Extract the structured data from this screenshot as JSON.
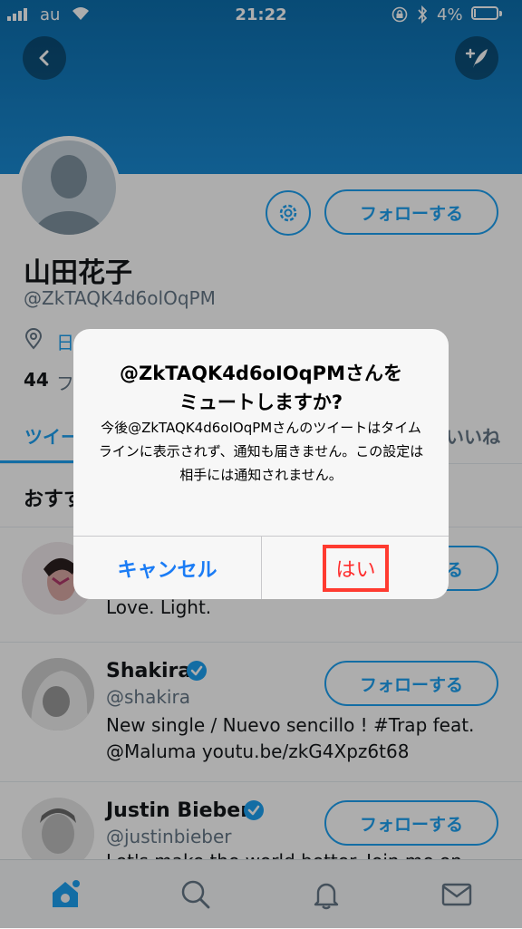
{
  "status_bar": {
    "carrier": "au",
    "time": "21:22",
    "battery": "4%"
  },
  "profile": {
    "name": "山田花子",
    "handle": "@ZkTAQK4d6olOqPM",
    "location_partial": "日",
    "following_count_partial": "44",
    "following_label_partial": "フ",
    "follow_label": "フォローする"
  },
  "tabs": {
    "tweets_partial": "ツイー",
    "likes_partial": "いいね"
  },
  "suggestions": {
    "heading_partial": "おすす",
    "items": [
      {
        "name": "",
        "handle": "",
        "bio": "Love. Light.",
        "follow_label": "フォローする"
      },
      {
        "name": "Shakira",
        "handle": "@shakira",
        "bio_line1": "New single / Nuevo sencillo ! #Trap feat.",
        "bio_line2": "@Maluma youtu.be/zkG4Xpz6t68",
        "follow_label": "フォローする"
      },
      {
        "name": "Justin Bieber",
        "handle": "@justinbieber",
        "bio_partial": "Let's make the world better. Join me on",
        "follow_label": "フォローする"
      }
    ]
  },
  "dialog": {
    "title_line1": "@ZkTAQK4d6oIOqPMさんを",
    "title_line2": "ミュートしますか?",
    "message": "今後@ZkTAQK4d6oIOqPMさんのツイートはタイムラインに表示されず、通知も届きません。この設定は相手には通知されません。",
    "cancel_label": "キャンセル",
    "confirm_label": "はい"
  },
  "colors": {
    "accent": "#1da1f2",
    "dialog_button": "#1b7cf5",
    "confirm_text": "#ff2d2d",
    "highlight_box": "#ff3b30"
  }
}
